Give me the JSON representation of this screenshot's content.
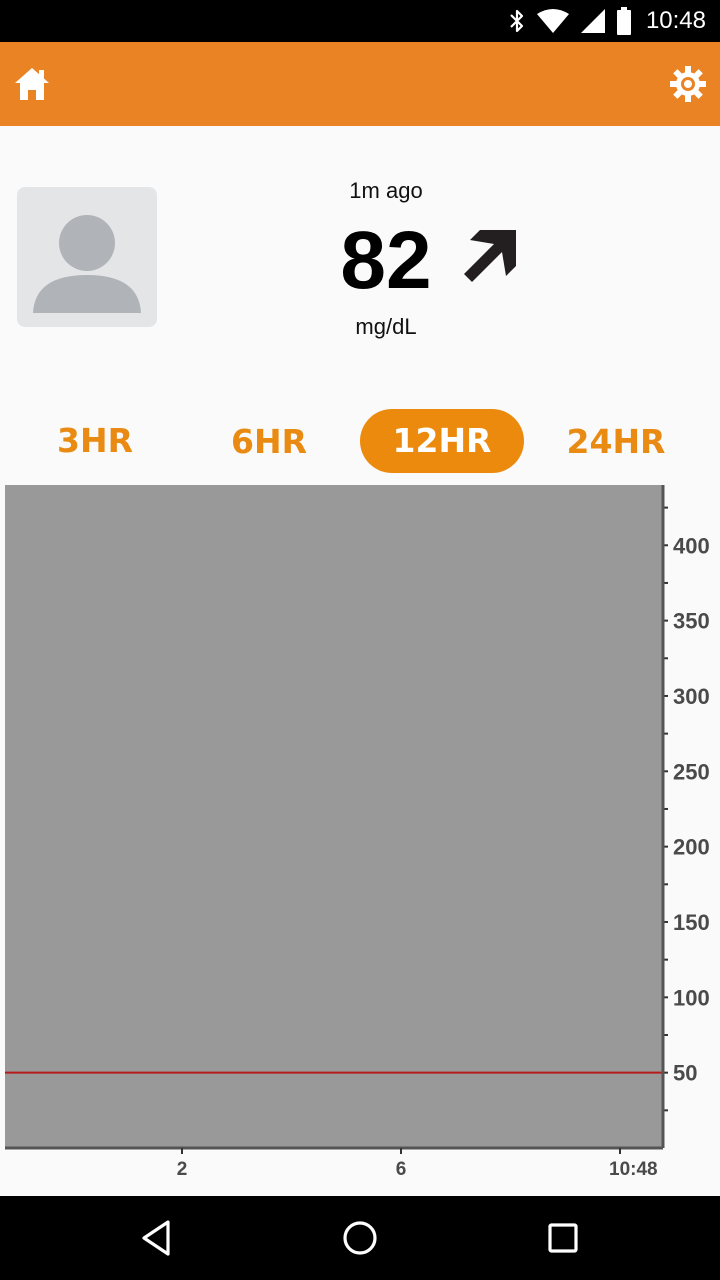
{
  "status_bar": {
    "time": "10:48",
    "icons": [
      "bluetooth-icon",
      "wifi-icon",
      "signal-icon",
      "battery-icon"
    ]
  },
  "app_bar": {
    "background_color": "#e98324",
    "home_icon": "home-icon",
    "settings_icon": "gear-icon"
  },
  "reading": {
    "time_ago": "1m ago",
    "value": "82",
    "unit": "mg/dL",
    "trend_icon": "arrow-up-right-icon"
  },
  "range_tabs": [
    {
      "label": "3HR",
      "active": false
    },
    {
      "label": "6HR",
      "active": false
    },
    {
      "label": "12HR",
      "active": true
    },
    {
      "label": "24HR",
      "active": false
    }
  ],
  "chart_data": {
    "type": "line",
    "x_tick_labels": [
      "2",
      "6",
      "10:48"
    ],
    "y_tick_labels": [
      "50",
      "100",
      "150",
      "200",
      "250",
      "300",
      "350",
      "400"
    ],
    "ylim": [
      0,
      440
    ],
    "threshold_line": {
      "value": 50,
      "color": "#b71c1c"
    },
    "plot_background": "#999999",
    "series": []
  },
  "nav_bar": {
    "buttons": [
      "back-icon",
      "home-circle-icon",
      "recents-icon"
    ]
  }
}
